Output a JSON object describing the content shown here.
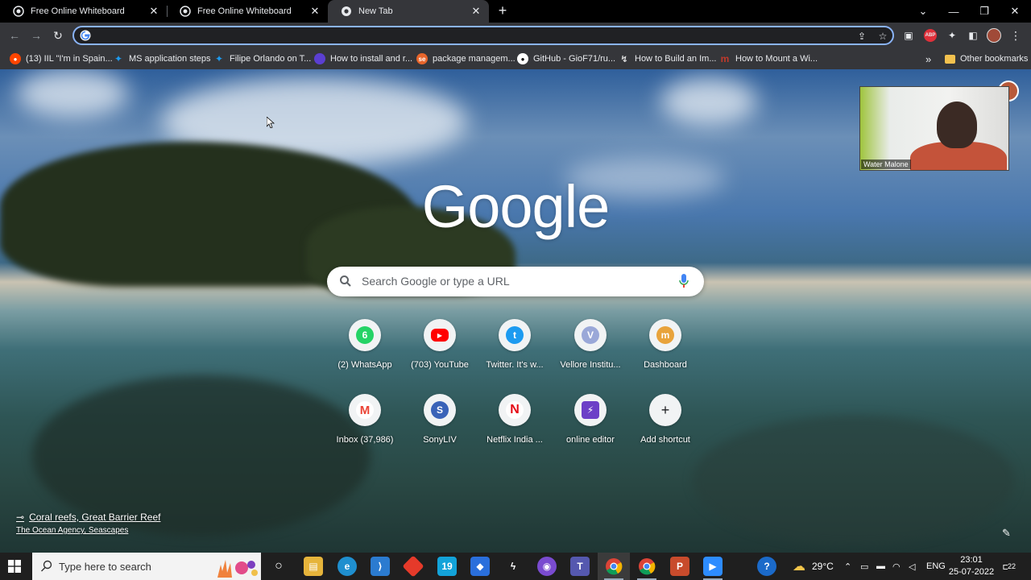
{
  "tabs": [
    {
      "title": "Free Online Whiteboard",
      "active": false
    },
    {
      "title": "Free Online Whiteboard",
      "active": false
    },
    {
      "title": "New Tab",
      "active": true
    }
  ],
  "icons": {
    "new_tab": "plus-icon",
    "back": "arrow-left-icon",
    "forward": "arrow-right-icon",
    "reload": "reload-icon",
    "share": "share-icon",
    "bookmark": "star-icon"
  },
  "omnibox": {
    "value": "",
    "placeholder": ""
  },
  "extensions": {
    "abp_label": "ABP"
  },
  "bookmarks": [
    {
      "label": "(13) IIL \"I'm in Spain...",
      "icon": "reddit-icon",
      "color": "#ff4500"
    },
    {
      "label": "MS application steps",
      "icon": "twitter-icon",
      "color": "#1d9bf0"
    },
    {
      "label": "Filipe Orlando on T...",
      "icon": "twitter-icon",
      "color": "#1d9bf0"
    },
    {
      "label": "How to install and r...",
      "icon": "circle-purple-icon",
      "color": "#5b3fd1"
    },
    {
      "label": "package managem...",
      "icon": "stackexchange-icon",
      "color": "#e8652b"
    },
    {
      "label": "GitHub - GioF71/ru...",
      "icon": "github-icon",
      "color": "#ffffff"
    },
    {
      "label": "How to Build an Im...",
      "icon": "arrow-icon",
      "color": "#dddddd"
    },
    {
      "label": "How to Mount a Wi...",
      "icon": "m-icon",
      "color": "#c0392b"
    }
  ],
  "bookmarks_overflow": "»",
  "other_bookmarks": "Other bookmarks",
  "ntp": {
    "logo": "Google",
    "search_placeholder": "Search Google or type a URL",
    "shortcuts": [
      {
        "label": "(2) WhatsApp",
        "glyph": "6",
        "color": "#25d366"
      },
      {
        "label": "(703) YouTube",
        "glyph": "▶",
        "color": "#ff0000"
      },
      {
        "label": "Twitter. It's w...",
        "glyph": "t",
        "color": "#1d9bf0"
      },
      {
        "label": "Vellore Institu...",
        "glyph": "V",
        "color": "#9aa8d8"
      },
      {
        "label": "Dashboard",
        "glyph": "m",
        "color": "#e8a33b"
      },
      {
        "label": "Inbox (37,986)",
        "glyph": "M",
        "color": "#ea4335"
      },
      {
        "label": "SonyLIV",
        "glyph": "S",
        "color": "#3a63b8"
      },
      {
        "label": "Netflix India ...",
        "glyph": "N",
        "color": "#e50914"
      },
      {
        "label": "online editor",
        "glyph": "⚡",
        "color": "#6c3fc7"
      },
      {
        "label": "Add shortcut",
        "glyph": "+",
        "color": "#f1f3f4"
      }
    ],
    "attribution_title": "Coral reefs, Great Barrier Reef",
    "attribution_sub": "The Ocean Agency, Seascapes"
  },
  "video_call": {
    "participant": "Water Malone"
  },
  "taskbar": {
    "search_placeholder": "Type here to search",
    "calendar_badge": "19",
    "temperature": "29°C",
    "language": "ENG",
    "time": "23:01",
    "date": "25-07-2022",
    "notifications": "22"
  }
}
